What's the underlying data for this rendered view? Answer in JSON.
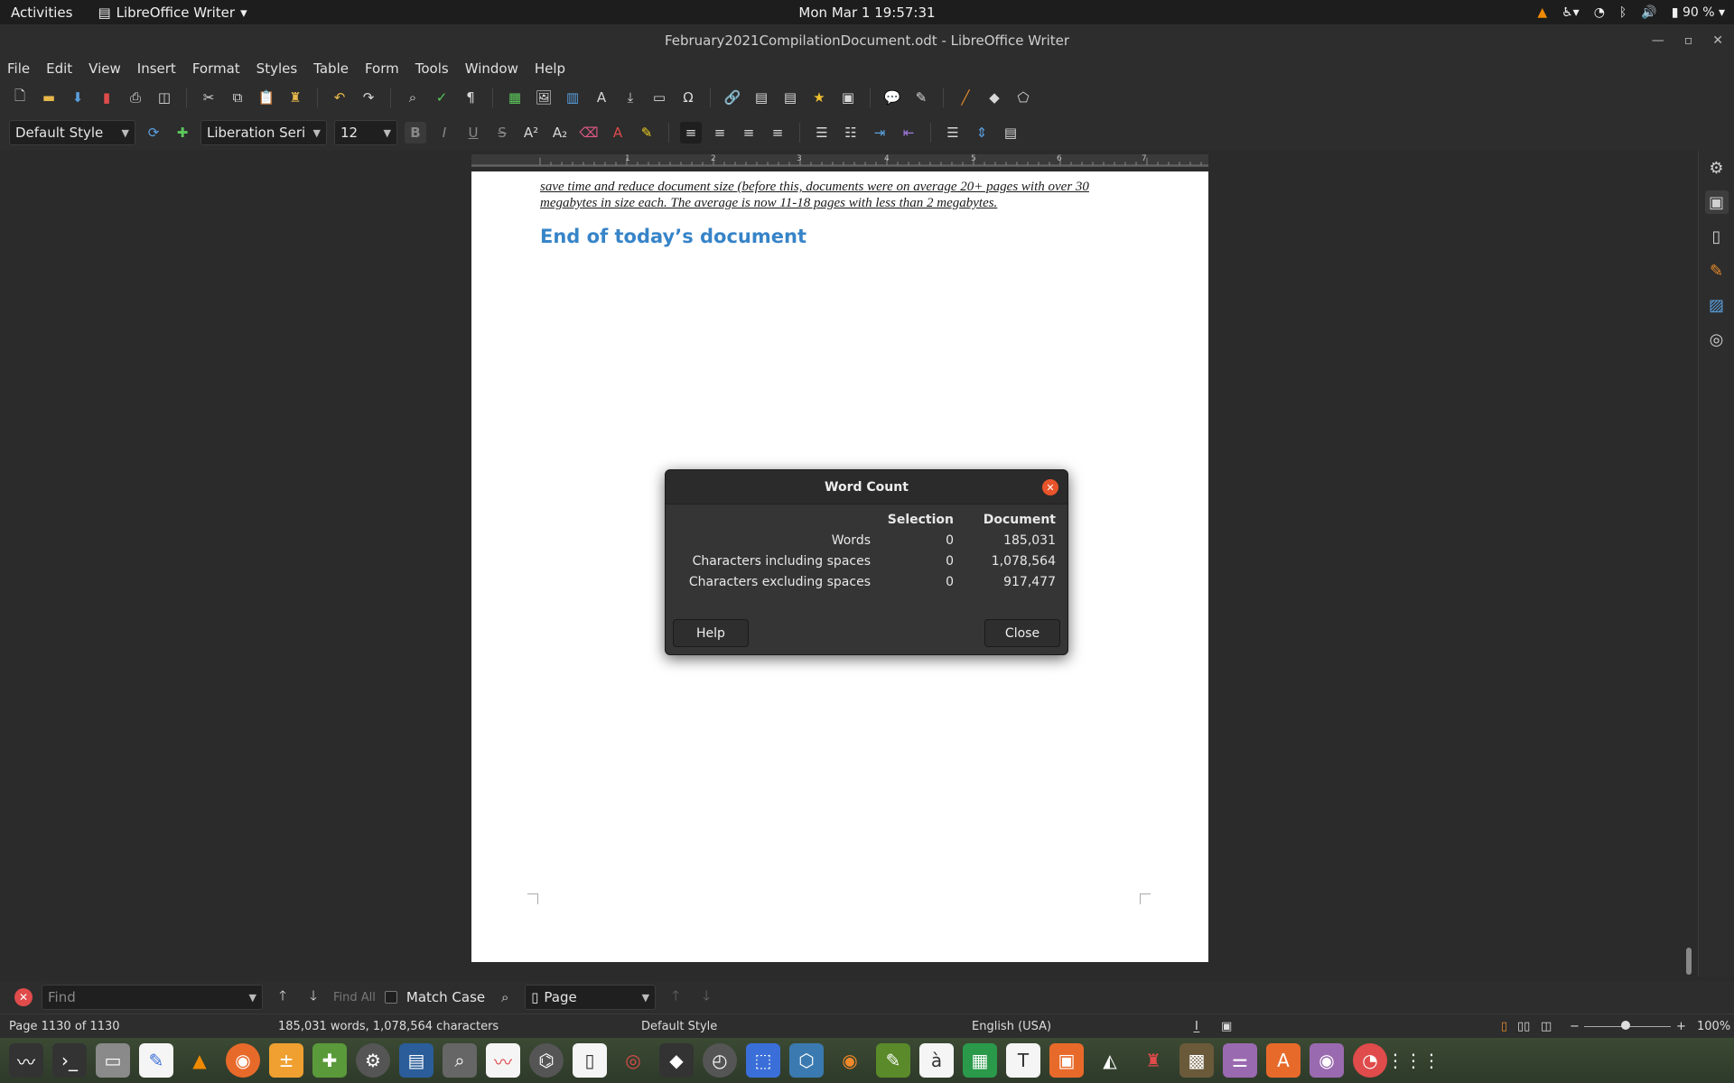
{
  "topbar": {
    "activities": "Activities",
    "app_menu": "LibreOffice Writer",
    "clock": "Mon Mar 1  19:57:31",
    "battery": "90 %"
  },
  "window": {
    "title": "February2021CompilationDocument.odt - LibreOffice Writer"
  },
  "menu": [
    "File",
    "Edit",
    "View",
    "Insert",
    "Format",
    "Styles",
    "Table",
    "Form",
    "Tools",
    "Window",
    "Help"
  ],
  "formatting": {
    "paragraph_style": "Default Style",
    "font_name": "Liberation Serif",
    "font_size": "12"
  },
  "document": {
    "paragraph": "save time and reduce document size (before this, documents were on average 20+ pages with over 30 megabytes in size each. The average is now 11-18 pages with less than 2 megabytes.",
    "heading": "End of today’s document",
    "heading_color": "#3784c8"
  },
  "dialog": {
    "title": "Word Count",
    "col_selection": "Selection",
    "col_document": "Document",
    "rows": [
      {
        "label": "Words",
        "selection": "0",
        "document": "185,031"
      },
      {
        "label": "Characters including spaces",
        "selection": "0",
        "document": "1,078,564"
      },
      {
        "label": "Characters excluding spaces",
        "selection": "0",
        "document": "917,477"
      }
    ],
    "help_label": "Help",
    "close_label": "Close"
  },
  "findbar": {
    "placeholder": "Find",
    "find_all": "Find All",
    "match_case": "Match Case",
    "search_scope": "Page"
  },
  "status": {
    "page": "Page 1130 of 1130",
    "counts": "185,031 words, 1,078,564 characters",
    "style": "Default Style",
    "language": "English (USA)",
    "zoom": "100%"
  },
  "ruler_numbers": [
    "1",
    "2",
    "3",
    "4",
    "5",
    "6",
    "7"
  ]
}
